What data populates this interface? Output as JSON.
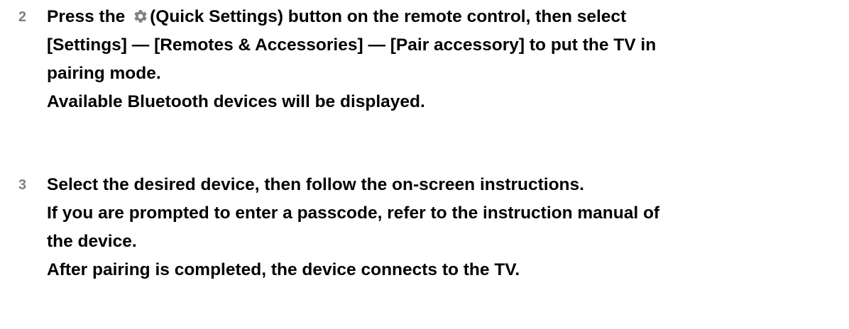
{
  "steps": [
    {
      "number": "2",
      "line1_before_icon": "Press the",
      "icon": "gear-icon",
      "line1_after_icon": "(Quick Settings) button on the remote control, then select",
      "line2": "[Settings] — [Remotes & Accessories] — [Pair accessory] to put the TV in",
      "line3": "pairing mode.",
      "line4": "Available Bluetooth devices will be displayed."
    },
    {
      "number": "3",
      "line1": "Select the desired device, then follow the on-screen instructions.",
      "line2": "If you are prompted to enter a passcode, refer to the instruction manual of",
      "line3": "the device.",
      "line4": "After pairing is completed, the device connects to the TV."
    }
  ],
  "colors": {
    "text": "#000000",
    "step_number": "#808080",
    "icon": "#808080"
  }
}
